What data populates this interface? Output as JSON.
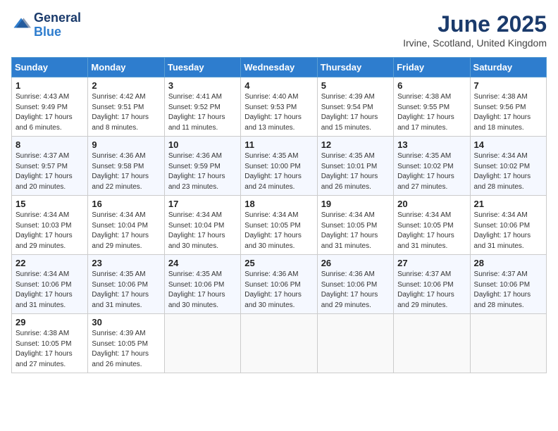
{
  "logo": {
    "line1": "General",
    "line2": "Blue"
  },
  "title": "June 2025",
  "location": "Irvine, Scotland, United Kingdom",
  "days_of_week": [
    "Sunday",
    "Monday",
    "Tuesday",
    "Wednesday",
    "Thursday",
    "Friday",
    "Saturday"
  ],
  "weeks": [
    [
      {
        "day": "1",
        "sunrise": "4:43 AM",
        "sunset": "9:49 PM",
        "daylight": "17 hours and 6 minutes."
      },
      {
        "day": "2",
        "sunrise": "4:42 AM",
        "sunset": "9:51 PM",
        "daylight": "17 hours and 8 minutes."
      },
      {
        "day": "3",
        "sunrise": "4:41 AM",
        "sunset": "9:52 PM",
        "daylight": "17 hours and 11 minutes."
      },
      {
        "day": "4",
        "sunrise": "4:40 AM",
        "sunset": "9:53 PM",
        "daylight": "17 hours and 13 minutes."
      },
      {
        "day": "5",
        "sunrise": "4:39 AM",
        "sunset": "9:54 PM",
        "daylight": "17 hours and 15 minutes."
      },
      {
        "day": "6",
        "sunrise": "4:38 AM",
        "sunset": "9:55 PM",
        "daylight": "17 hours and 17 minutes."
      },
      {
        "day": "7",
        "sunrise": "4:38 AM",
        "sunset": "9:56 PM",
        "daylight": "17 hours and 18 minutes."
      }
    ],
    [
      {
        "day": "8",
        "sunrise": "4:37 AM",
        "sunset": "9:57 PM",
        "daylight": "17 hours and 20 minutes."
      },
      {
        "day": "9",
        "sunrise": "4:36 AM",
        "sunset": "9:58 PM",
        "daylight": "17 hours and 22 minutes."
      },
      {
        "day": "10",
        "sunrise": "4:36 AM",
        "sunset": "9:59 PM",
        "daylight": "17 hours and 23 minutes."
      },
      {
        "day": "11",
        "sunrise": "4:35 AM",
        "sunset": "10:00 PM",
        "daylight": "17 hours and 24 minutes."
      },
      {
        "day": "12",
        "sunrise": "4:35 AM",
        "sunset": "10:01 PM",
        "daylight": "17 hours and 26 minutes."
      },
      {
        "day": "13",
        "sunrise": "4:35 AM",
        "sunset": "10:02 PM",
        "daylight": "17 hours and 27 minutes."
      },
      {
        "day": "14",
        "sunrise": "4:34 AM",
        "sunset": "10:02 PM",
        "daylight": "17 hours and 28 minutes."
      }
    ],
    [
      {
        "day": "15",
        "sunrise": "4:34 AM",
        "sunset": "10:03 PM",
        "daylight": "17 hours and 29 minutes."
      },
      {
        "day": "16",
        "sunrise": "4:34 AM",
        "sunset": "10:04 PM",
        "daylight": "17 hours and 29 minutes."
      },
      {
        "day": "17",
        "sunrise": "4:34 AM",
        "sunset": "10:04 PM",
        "daylight": "17 hours and 30 minutes."
      },
      {
        "day": "18",
        "sunrise": "4:34 AM",
        "sunset": "10:05 PM",
        "daylight": "17 hours and 30 minutes."
      },
      {
        "day": "19",
        "sunrise": "4:34 AM",
        "sunset": "10:05 PM",
        "daylight": "17 hours and 31 minutes."
      },
      {
        "day": "20",
        "sunrise": "4:34 AM",
        "sunset": "10:05 PM",
        "daylight": "17 hours and 31 minutes."
      },
      {
        "day": "21",
        "sunrise": "4:34 AM",
        "sunset": "10:06 PM",
        "daylight": "17 hours and 31 minutes."
      }
    ],
    [
      {
        "day": "22",
        "sunrise": "4:34 AM",
        "sunset": "10:06 PM",
        "daylight": "17 hours and 31 minutes."
      },
      {
        "day": "23",
        "sunrise": "4:35 AM",
        "sunset": "10:06 PM",
        "daylight": "17 hours and 31 minutes."
      },
      {
        "day": "24",
        "sunrise": "4:35 AM",
        "sunset": "10:06 PM",
        "daylight": "17 hours and 30 minutes."
      },
      {
        "day": "25",
        "sunrise": "4:36 AM",
        "sunset": "10:06 PM",
        "daylight": "17 hours and 30 minutes."
      },
      {
        "day": "26",
        "sunrise": "4:36 AM",
        "sunset": "10:06 PM",
        "daylight": "17 hours and 29 minutes."
      },
      {
        "day": "27",
        "sunrise": "4:37 AM",
        "sunset": "10:06 PM",
        "daylight": "17 hours and 29 minutes."
      },
      {
        "day": "28",
        "sunrise": "4:37 AM",
        "sunset": "10:06 PM",
        "daylight": "17 hours and 28 minutes."
      }
    ],
    [
      {
        "day": "29",
        "sunrise": "4:38 AM",
        "sunset": "10:05 PM",
        "daylight": "17 hours and 27 minutes."
      },
      {
        "day": "30",
        "sunrise": "4:39 AM",
        "sunset": "10:05 PM",
        "daylight": "17 hours and 26 minutes."
      },
      null,
      null,
      null,
      null,
      null
    ]
  ]
}
